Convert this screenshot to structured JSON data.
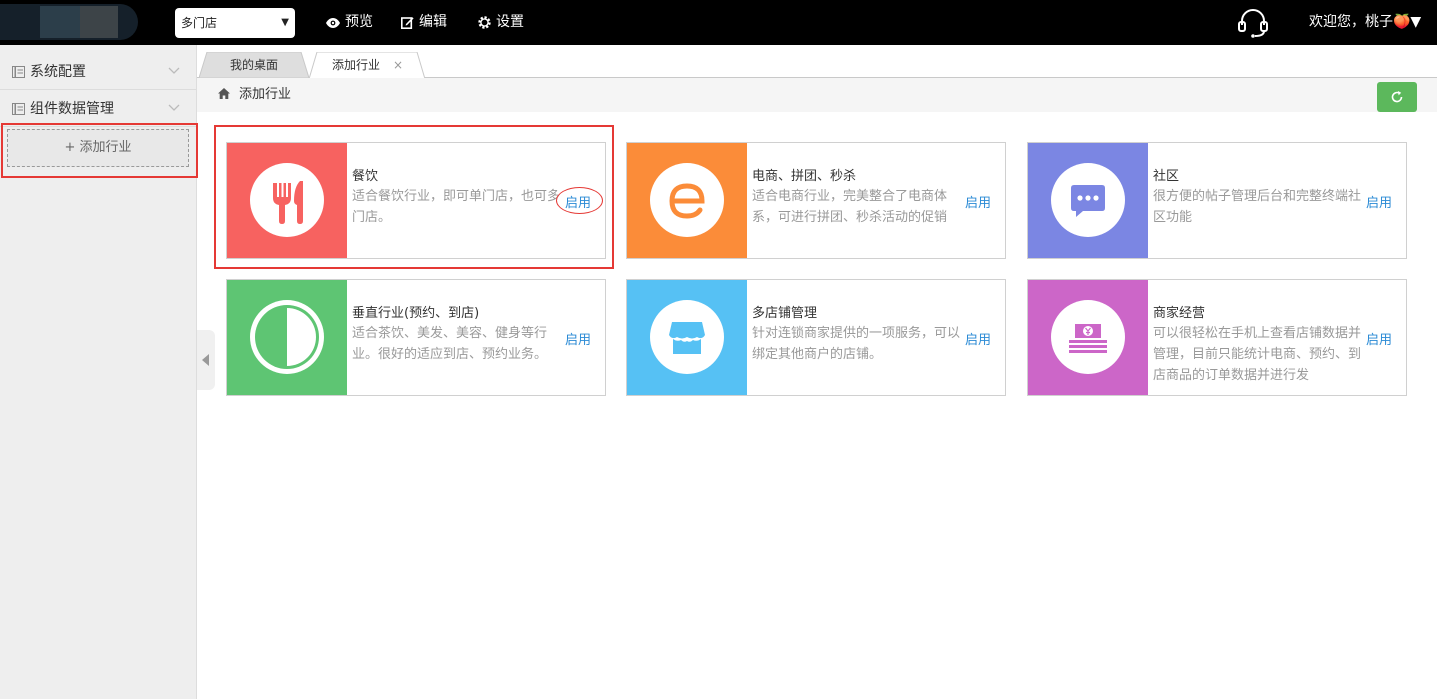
{
  "header": {
    "store_select": "多门店",
    "nav": [
      {
        "label": "预览",
        "icon": "eye-icon"
      },
      {
        "label": "编辑",
        "icon": "edit-icon"
      },
      {
        "label": "设置",
        "icon": "gear-icon"
      }
    ],
    "welcome": "欢迎您，桃子🍑▼"
  },
  "sidebar": {
    "groups": [
      {
        "label": "系统配置"
      },
      {
        "label": "组件数据管理"
      }
    ],
    "add_button": "+ 添加行业"
  },
  "tabs": [
    {
      "label": "我的桌面"
    },
    {
      "label": "添加行业",
      "close": "×"
    }
  ],
  "breadcrumb": "添加行业",
  "cards": [
    {
      "title": "餐饮",
      "desc": "适合餐饮行业，即可单门店，也可多门店。",
      "action": "启用",
      "color": "#f76260",
      "icon": "fork-knife-icon"
    },
    {
      "title": "电商、拼团、秒杀",
      "desc": "适合电商行业，完美整合了电商体系，可进行拼团、秒杀活动的促销",
      "action": "启用",
      "color": "#fb8c39",
      "icon": "ecommerce-e-icon"
    },
    {
      "title": "社区",
      "desc": "很方便的帖子管理后台和完整终端社区功能",
      "action": "启用",
      "color": "#7b86e3",
      "icon": "chat-bubble-icon"
    },
    {
      "title": "垂直行业(预约、到店)",
      "desc": "适合茶饮、美发、美容、健身等行业。很好的适应到店、预约业务。",
      "action": "启用",
      "color": "#5ec573",
      "icon": "half-circle-icon"
    },
    {
      "title": "多店铺管理",
      "desc": "针对连锁商家提供的一项服务，可以绑定其他商户的店铺。",
      "action": "启用",
      "color": "#56c1f4",
      "icon": "storefront-icon"
    },
    {
      "title": "商家经营",
      "desc": "可以很轻松在手机上查看店铺数据并管理，目前只能统计电商、预约、到店商品的订单数据并进行发",
      "action": "启用",
      "color": "#cc66c8",
      "icon": "money-stack-icon"
    }
  ]
}
